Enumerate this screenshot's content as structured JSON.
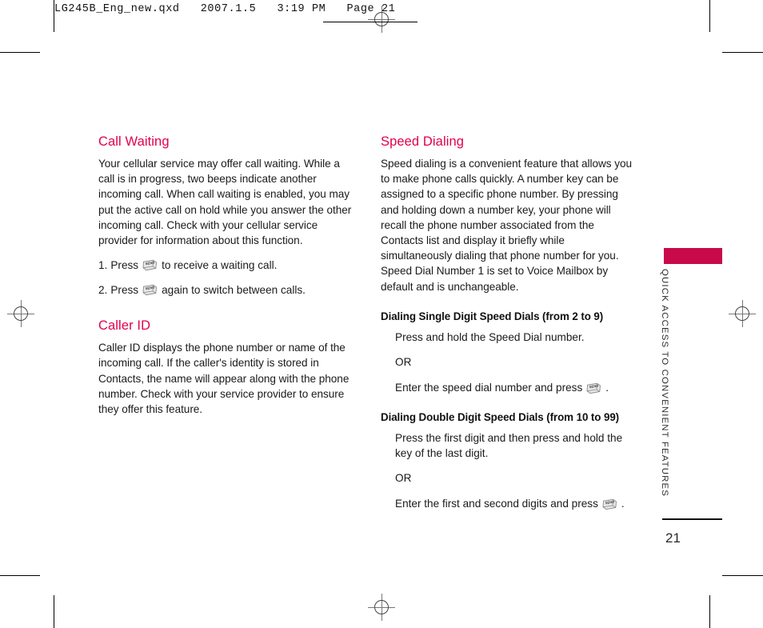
{
  "file_header": {
    "text": "LG245B_Eng_new.qxd   2007.1.5   3:19 PM   Page 21"
  },
  "colors": {
    "heading": "#e0004d",
    "side_tab": "#c80a4b",
    "body_text": "#1a1a1a"
  },
  "left_column": {
    "sections": [
      {
        "title": "Call Waiting",
        "paragraphs": [
          "Your cellular service may offer call waiting. While a call is in progress, two beeps indicate another incoming call. When call waiting is enabled, you may put the active call on hold while you answer the other incoming call. Check with your cellular service provider for information about this function."
        ],
        "steps": [
          {
            "num": "1.",
            "before": "Press",
            "icon": "send-key-icon",
            "after": "to receive a waiting call."
          },
          {
            "num": "2.",
            "before": "Press",
            "icon": "send-key-icon",
            "after": "again to switch between calls."
          }
        ]
      },
      {
        "title": "Caller ID",
        "paragraphs": [
          "Caller ID displays the phone number or name of the incoming call. If the caller's identity is stored in Contacts, the name will appear along with the phone number. Check with your service provider to ensure they offer this feature."
        ]
      }
    ]
  },
  "right_column": {
    "title": "Speed Dialing",
    "intro": "Speed dialing is a convenient feature that allows you to make phone calls quickly. A number key can be assigned to a specific phone number.  By pressing and holding down a number key, your phone will recall the phone number associated from the Contacts list and display it briefly while simultaneously dialing that phone number for you. Speed Dial Number 1 is set to Voice Mailbox by default and is unchangeable.",
    "subsections": [
      {
        "heading": "Dialing Single Digit Speed Dials (from 2 to 9)",
        "line1": "Press and hold the Speed Dial number.",
        "or": "OR",
        "line2_before": "Enter the speed dial number and press",
        "line2_icon": "send-key-icon",
        "line2_after": "."
      },
      {
        "heading": "Dialing Double Digit Speed Dials (from 10 to 99)",
        "line1": "Press the first digit and then press and hold the key of the last digit.",
        "or": "OR",
        "line2_before": "Enter the first and second digits and press",
        "line2_icon": "send-key-icon",
        "line2_after": "."
      }
    ]
  },
  "side_tab": {
    "label": "QUICK ACCESS TO CONVENIENT FEATURES",
    "page_number": "21"
  }
}
